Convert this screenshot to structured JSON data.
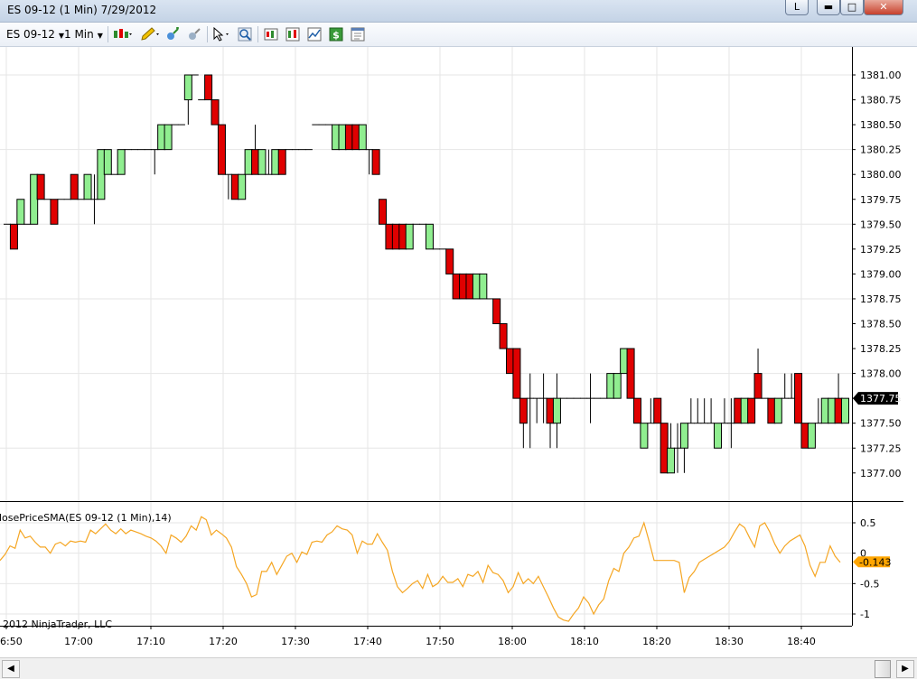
{
  "window": {
    "title": "ES 09-12 (1 Min)  7/29/2012",
    "btn_l": "L"
  },
  "toolbar": {
    "instrument": "ES 09-12",
    "interval": "1 Min"
  },
  "price_axis": {
    "labels": [
      "1381.00",
      "1380.75",
      "1380.50",
      "1380.25",
      "1380.00",
      "1379.75",
      "1379.50",
      "1379.25",
      "1379.00",
      "1378.75",
      "1378.50",
      "1378.25",
      "1378.00",
      "1377.75",
      "1377.50",
      "1377.25",
      "1377.00"
    ],
    "last_price": "1377.75"
  },
  "indicator": {
    "label": "losePriceSMA(ES 09-12 (1 Min),14)",
    "axis_labels": [
      "0.5",
      "0",
      "-0.5",
      "-1"
    ],
    "last_value": "-0.143"
  },
  "time_axis": {
    "labels": [
      "6:50",
      "17:00",
      "17:10",
      "17:20",
      "17:30",
      "17:40",
      "17:50",
      "18:00",
      "18:10",
      "18:20",
      "18:30",
      "18:40"
    ]
  },
  "copyright": "2012 NinjaTrader, LLC",
  "colors": {
    "up": "#90ee90",
    "down": "#e00000",
    "indicator": "#f5a623",
    "price_marker": "#000000",
    "value_marker": "#ffa500"
  },
  "chart_data": {
    "type": "candlestick",
    "y_step": 0.25,
    "ylim": [
      1376.75,
      1381.25
    ],
    "indicator_ylim": [
      -1.2,
      0.7
    ],
    "bars": [
      [
        1379.5,
        1379.5,
        1379.5,
        1379.5
      ],
      [
        1379.5,
        1379.5,
        1379.25,
        1379.25
      ],
      [
        1379.5,
        1379.75,
        1379.5,
        1379.75
      ],
      [
        1379.5,
        1379.5,
        1379.5,
        1379.5
      ],
      [
        1379.5,
        1380.0,
        1379.5,
        1380.0
      ],
      [
        1380.0,
        1380.0,
        1379.75,
        1379.75
      ],
      [
        1379.75,
        1379.75,
        1379.75,
        1379.75
      ],
      [
        1379.75,
        1379.75,
        1379.5,
        1379.5
      ],
      [
        1379.75,
        1379.75,
        1379.75,
        1379.75
      ],
      [
        1379.75,
        1379.75,
        1379.75,
        1379.75
      ],
      [
        1380.0,
        1380.0,
        1379.75,
        1379.75
      ],
      [
        1379.75,
        1379.75,
        1379.75,
        1379.75
      ],
      [
        1379.75,
        1380.0,
        1379.75,
        1380.0
      ],
      [
        1379.75,
        1380.0,
        1379.5,
        1379.75
      ],
      [
        1379.75,
        1380.25,
        1379.75,
        1380.25
      ],
      [
        1380.0,
        1380.25,
        1380.0,
        1380.25
      ],
      [
        1380.0,
        1380.0,
        1380.0,
        1380.0
      ],
      [
        1380.0,
        1380.25,
        1380.0,
        1380.25
      ],
      [
        1380.25,
        1380.25,
        1380.25,
        1380.25
      ],
      [
        1380.25,
        1380.25,
        1380.25,
        1380.25
      ],
      [
        1380.25,
        1380.25,
        1380.25,
        1380.25
      ],
      [
        1380.25,
        1380.25,
        1380.25,
        1380.25
      ],
      [
        1380.25,
        1380.25,
        1380.0,
        1380.25
      ],
      [
        1380.25,
        1380.5,
        1380.25,
        1380.5
      ],
      [
        1380.25,
        1380.5,
        1380.25,
        1380.5
      ],
      [
        1380.5,
        1380.5,
        1380.5,
        1380.5
      ],
      [
        1380.5,
        1380.5,
        1380.5,
        1380.5
      ],
      [
        1380.75,
        1381.0,
        1380.5,
        1381.0
      ],
      [
        1381.0,
        1381.0,
        1381.0,
        1381.0
      ],
      [
        1380.75,
        1380.75,
        1380.75,
        1380.75
      ],
      [
        1381.0,
        1381.0,
        1380.75,
        1380.75
      ],
      [
        1380.75,
        1380.75,
        1380.5,
        1380.5
      ],
      [
        1380.5,
        1380.5,
        1380.0,
        1380.0
      ],
      [
        1380.0,
        1380.0,
        1379.75,
        1380.0
      ],
      [
        1380.0,
        1380.0,
        1379.75,
        1379.75
      ],
      [
        1379.75,
        1380.0,
        1379.75,
        1380.0
      ],
      [
        1380.0,
        1380.25,
        1380.0,
        1380.25
      ],
      [
        1380.25,
        1380.5,
        1380.0,
        1380.0
      ],
      [
        1380.0,
        1380.25,
        1380.0,
        1380.25
      ],
      [
        1380.0,
        1380.25,
        1380.0,
        1380.0
      ],
      [
        1380.0,
        1380.25,
        1380.0,
        1380.25
      ],
      [
        1380.25,
        1380.25,
        1380.0,
        1380.0
      ],
      [
        1380.25,
        1380.25,
        1380.25,
        1380.25
      ],
      [
        1380.25,
        1380.25,
        1380.25,
        1380.25
      ],
      [
        1380.25,
        1380.25,
        1380.25,
        1380.25
      ],
      [
        1380.25,
        1380.25,
        1380.25,
        1380.25
      ],
      [
        1380.5,
        1380.5,
        1380.5,
        1380.5
      ],
      [
        1380.5,
        1380.5,
        1380.5,
        1380.5
      ],
      [
        1380.5,
        1380.5,
        1380.5,
        1380.5
      ],
      [
        1380.25,
        1380.5,
        1380.25,
        1380.5
      ],
      [
        1380.25,
        1380.5,
        1380.25,
        1380.5
      ],
      [
        1380.5,
        1380.5,
        1380.25,
        1380.25
      ],
      [
        1380.5,
        1380.5,
        1380.25,
        1380.25
      ],
      [
        1380.25,
        1380.5,
        1380.25,
        1380.5
      ],
      [
        1380.25,
        1380.25,
        1380.0,
        1380.25
      ],
      [
        1380.25,
        1380.25,
        1380.0,
        1380.0
      ],
      [
        1379.75,
        1379.75,
        1379.5,
        1379.5
      ],
      [
        1379.5,
        1379.5,
        1379.25,
        1379.25
      ],
      [
        1379.5,
        1379.5,
        1379.25,
        1379.25
      ],
      [
        1379.5,
        1379.5,
        1379.25,
        1379.25
      ],
      [
        1379.25,
        1379.5,
        1379.25,
        1379.5
      ],
      [
        1379.5,
        1379.5,
        1379.5,
        1379.5
      ],
      [
        1379.5,
        1379.5,
        1379.5,
        1379.5
      ],
      [
        1379.25,
        1379.5,
        1379.25,
        1379.5
      ],
      [
        1379.25,
        1379.25,
        1379.25,
        1379.25
      ],
      [
        1379.25,
        1379.25,
        1379.25,
        1379.25
      ],
      [
        1379.25,
        1379.25,
        1379.0,
        1379.0
      ],
      [
        1379.0,
        1379.0,
        1378.75,
        1378.75
      ],
      [
        1379.0,
        1379.0,
        1378.75,
        1378.75
      ],
      [
        1379.0,
        1379.0,
        1378.75,
        1378.75
      ],
      [
        1378.75,
        1379.0,
        1378.75,
        1379.0
      ],
      [
        1378.75,
        1379.0,
        1378.75,
        1379.0
      ],
      [
        1378.75,
        1378.75,
        1378.75,
        1378.75
      ],
      [
        1378.75,
        1378.75,
        1378.5,
        1378.5
      ],
      [
        1378.5,
        1378.5,
        1378.25,
        1378.25
      ],
      [
        1378.25,
        1378.25,
        1378.0,
        1378.0
      ],
      [
        1378.25,
        1378.25,
        1377.75,
        1377.75
      ],
      [
        1377.75,
        1377.75,
        1377.25,
        1377.5
      ],
      [
        1377.75,
        1378.0,
        1377.25,
        1377.75
      ],
      [
        1377.75,
        1377.75,
        1377.5,
        1377.75
      ],
      [
        1377.75,
        1378.0,
        1377.5,
        1377.75
      ],
      [
        1377.75,
        1377.75,
        1377.25,
        1377.5
      ],
      [
        1377.5,
        1378.0,
        1377.25,
        1377.75
      ],
      [
        1377.75,
        1377.75,
        1377.75,
        1377.75
      ],
      [
        1377.75,
        1377.75,
        1377.75,
        1377.75
      ],
      [
        1377.75,
        1377.75,
        1377.75,
        1377.75
      ],
      [
        1377.75,
        1377.75,
        1377.75,
        1377.75
      ],
      [
        1377.75,
        1378.0,
        1377.5,
        1377.75
      ],
      [
        1377.75,
        1377.75,
        1377.75,
        1377.75
      ],
      [
        1377.75,
        1377.75,
        1377.75,
        1377.75
      ],
      [
        1377.75,
        1378.0,
        1377.75,
        1378.0
      ],
      [
        1377.75,
        1378.0,
        1377.75,
        1378.0
      ],
      [
        1378.0,
        1378.25,
        1378.0,
        1378.25
      ],
      [
        1378.25,
        1378.25,
        1377.75,
        1377.75
      ],
      [
        1377.75,
        1377.75,
        1377.5,
        1377.5
      ],
      [
        1377.25,
        1377.5,
        1377.25,
        1377.5
      ],
      [
        1377.5,
        1377.75,
        1377.5,
        1377.5
      ],
      [
        1377.75,
        1377.75,
        1377.5,
        1377.5
      ],
      [
        1377.5,
        1377.5,
        1377.0,
        1377.0
      ],
      [
        1377.0,
        1377.5,
        1377.0,
        1377.25
      ],
      [
        1377.25,
        1377.5,
        1377.0,
        1377.25
      ],
      [
        1377.25,
        1377.5,
        1377.0,
        1377.5
      ],
      [
        1377.5,
        1377.75,
        1377.5,
        1377.5
      ],
      [
        1377.5,
        1377.75,
        1377.5,
        1377.5
      ],
      [
        1377.5,
        1377.75,
        1377.5,
        1377.5
      ],
      [
        1377.5,
        1377.75,
        1377.5,
        1377.5
      ],
      [
        1377.25,
        1377.5,
        1377.25,
        1377.5
      ],
      [
        1377.5,
        1377.75,
        1377.5,
        1377.5
      ],
      [
        1377.5,
        1377.75,
        1377.25,
        1377.5
      ],
      [
        1377.75,
        1377.75,
        1377.5,
        1377.5
      ],
      [
        1377.5,
        1377.75,
        1377.5,
        1377.75
      ],
      [
        1377.75,
        1377.75,
        1377.5,
        1377.5
      ],
      [
        1378.0,
        1378.25,
        1377.75,
        1377.75
      ],
      [
        1377.75,
        1377.75,
        1377.75,
        1377.75
      ],
      [
        1377.75,
        1377.75,
        1377.5,
        1377.5
      ],
      [
        1377.5,
        1377.75,
        1377.5,
        1377.75
      ],
      [
        1377.75,
        1378.0,
        1377.75,
        1377.75
      ],
      [
        1377.75,
        1378.0,
        1377.75,
        1377.75
      ],
      [
        1378.0,
        1378.0,
        1377.5,
        1377.5
      ],
      [
        1377.5,
        1377.5,
        1377.25,
        1377.25
      ],
      [
        1377.25,
        1377.5,
        1377.25,
        1377.5
      ],
      [
        1377.5,
        1377.75,
        1377.5,
        1377.5
      ],
      [
        1377.5,
        1377.75,
        1377.5,
        1377.75
      ],
      [
        1377.5,
        1377.75,
        1377.5,
        1377.75
      ],
      [
        1377.75,
        1378.0,
        1377.5,
        1377.5
      ],
      [
        1377.5,
        1377.75,
        1377.5,
        1377.75
      ]
    ],
    "sma": [
      -0.12,
      -0.02,
      0.12,
      0.08,
      0.38,
      0.25,
      0.28,
      0.18,
      0.1,
      0.1,
      0.0,
      0.15,
      0.18,
      0.12,
      0.2,
      0.18,
      0.2,
      0.18,
      0.38,
      0.32,
      0.4,
      0.48,
      0.38,
      0.32,
      0.4,
      0.32,
      0.38,
      0.35,
      0.32,
      0.28,
      0.25,
      0.2,
      0.12,
      0.0,
      0.3,
      0.25,
      0.18,
      0.28,
      0.45,
      0.38,
      0.6,
      0.55,
      0.3,
      0.38,
      0.32,
      0.25,
      0.1,
      -0.22,
      -0.35,
      -0.5,
      -0.72,
      -0.68,
      -0.3,
      -0.3,
      -0.15,
      -0.35,
      -0.2,
      -0.05,
      0.0,
      -0.15,
      0.02,
      -0.02,
      0.18,
      0.2,
      0.18,
      0.3,
      0.35,
      0.45,
      0.4,
      0.38,
      0.3,
      0.0,
      0.2,
      0.15,
      0.15,
      0.32,
      0.18,
      0.05,
      -0.3,
      -0.55,
      -0.65,
      -0.58,
      -0.5,
      -0.45,
      -0.58,
      -0.35,
      -0.55,
      -0.5,
      -0.38,
      -0.48,
      -0.48,
      -0.42,
      -0.55,
      -0.35,
      -0.38,
      -0.3,
      -0.48,
      -0.2,
      -0.32,
      -0.35,
      -0.45,
      -0.65,
      -0.55,
      -0.32,
      -0.5,
      -0.42,
      -0.5,
      -0.38,
      -0.55,
      -0.72,
      -0.9,
      -1.05,
      -1.1,
      -1.12,
      -1.0,
      -0.9,
      -0.72,
      -0.82,
      -1.0,
      -0.85,
      -0.75,
      -0.45,
      -0.25,
      -0.3,
      0.0,
      0.1,
      0.25,
      0.28,
      0.5,
      0.2,
      -0.12,
      -0.12,
      -0.12,
      -0.12,
      -0.12,
      -0.15,
      -0.65,
      -0.4,
      -0.3,
      -0.15,
      -0.1,
      -0.05,
      0.0,
      0.05,
      0.1,
      0.2,
      0.35,
      0.48,
      0.42,
      0.25,
      0.1,
      0.45,
      0.5,
      0.35,
      0.15,
      0.0,
      0.12,
      0.2,
      0.25,
      0.3,
      0.12,
      -0.2,
      -0.38,
      -0.15,
      -0.15,
      0.12,
      -0.05,
      -0.15
    ]
  }
}
